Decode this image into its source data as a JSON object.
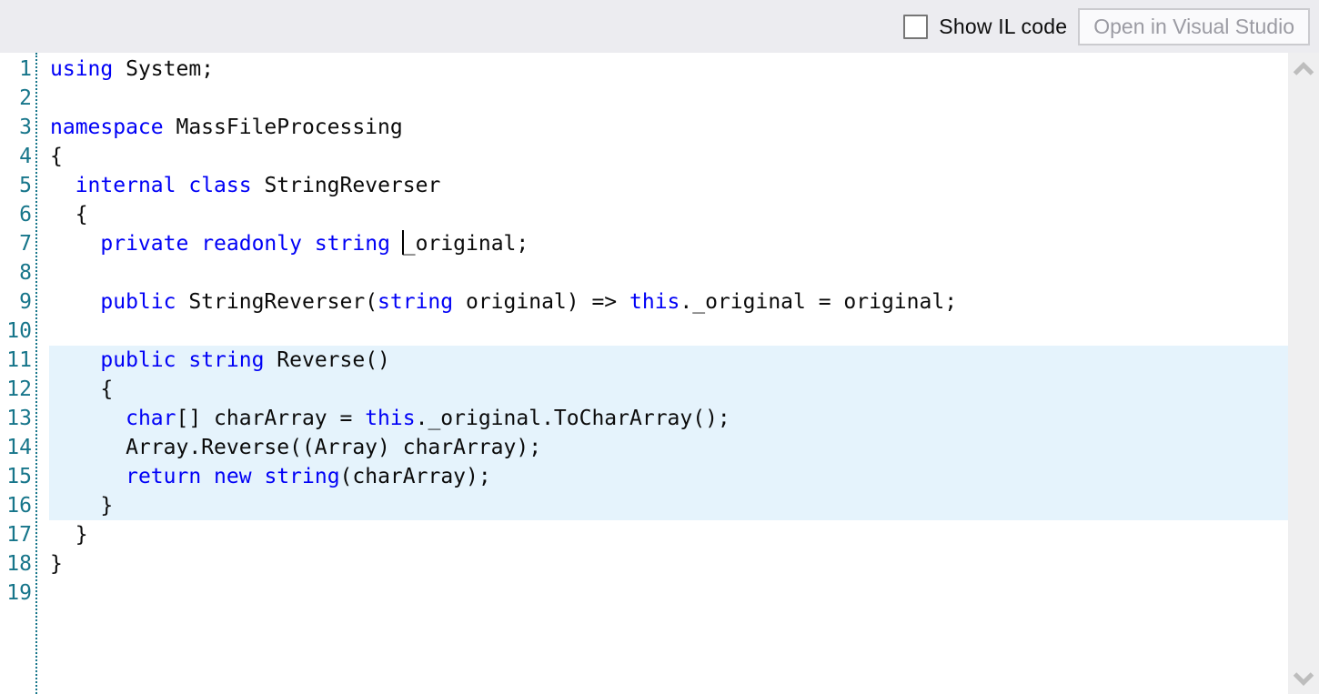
{
  "toolbar": {
    "show_il_label": "Show IL code",
    "show_il_checked": false,
    "open_vs_label": "Open in Visual Studio"
  },
  "editor": {
    "language": "csharp",
    "highlight_start_line": 11,
    "highlight_end_line": 16,
    "caret_line": 7,
    "lines": [
      {
        "n": "1",
        "tokens": [
          [
            "k",
            "using"
          ],
          [
            "p",
            " System;"
          ]
        ]
      },
      {
        "n": "2",
        "tokens": []
      },
      {
        "n": "3",
        "tokens": [
          [
            "k",
            "namespace"
          ],
          [
            "p",
            " MassFileProcessing"
          ]
        ]
      },
      {
        "n": "4",
        "tokens": [
          [
            "p",
            "{"
          ]
        ]
      },
      {
        "n": "5",
        "tokens": [
          [
            "p",
            "  "
          ],
          [
            "k",
            "internal"
          ],
          [
            "p",
            " "
          ],
          [
            "k",
            "class"
          ],
          [
            "p",
            " StringReverser"
          ]
        ]
      },
      {
        "n": "6",
        "tokens": [
          [
            "p",
            "  {"
          ]
        ]
      },
      {
        "n": "7",
        "tokens": [
          [
            "p",
            "    "
          ],
          [
            "k",
            "private"
          ],
          [
            "p",
            " "
          ],
          [
            "k",
            "readonly"
          ],
          [
            "p",
            " "
          ],
          [
            "k",
            "string"
          ],
          [
            "p",
            " "
          ],
          [
            "caret",
            ""
          ],
          [
            "p",
            "_original;"
          ]
        ]
      },
      {
        "n": "8",
        "tokens": []
      },
      {
        "n": "9",
        "tokens": [
          [
            "p",
            "    "
          ],
          [
            "k",
            "public"
          ],
          [
            "p",
            " StringReverser("
          ],
          [
            "k",
            "string"
          ],
          [
            "p",
            " original) => "
          ],
          [
            "k",
            "this"
          ],
          [
            "p",
            "._original = original;"
          ]
        ]
      },
      {
        "n": "10",
        "tokens": []
      },
      {
        "n": "11",
        "tokens": [
          [
            "p",
            "    "
          ],
          [
            "k",
            "public"
          ],
          [
            "p",
            " "
          ],
          [
            "k",
            "string"
          ],
          [
            "p",
            " Reverse()"
          ]
        ]
      },
      {
        "n": "12",
        "tokens": [
          [
            "p",
            "    {"
          ]
        ]
      },
      {
        "n": "13",
        "tokens": [
          [
            "p",
            "      "
          ],
          [
            "k",
            "char"
          ],
          [
            "p",
            "[] charArray = "
          ],
          [
            "k",
            "this"
          ],
          [
            "p",
            "._original.ToCharArray();"
          ]
        ]
      },
      {
        "n": "14",
        "tokens": [
          [
            "p",
            "      Array.Reverse((Array) charArray);"
          ]
        ]
      },
      {
        "n": "15",
        "tokens": [
          [
            "p",
            "      "
          ],
          [
            "k",
            "return"
          ],
          [
            "p",
            " "
          ],
          [
            "k",
            "new"
          ],
          [
            "p",
            " "
          ],
          [
            "k",
            "string"
          ],
          [
            "p",
            "(charArray);"
          ]
        ]
      },
      {
        "n": "16",
        "tokens": [
          [
            "p",
            "    }"
          ]
        ]
      },
      {
        "n": "17",
        "tokens": [
          [
            "p",
            "  }"
          ]
        ]
      },
      {
        "n": "18",
        "tokens": [
          [
            "p",
            "}"
          ]
        ]
      },
      {
        "n": "19",
        "tokens": []
      }
    ]
  },
  "colors": {
    "keyword": "#0000F6",
    "plain": "#0B0B0B",
    "line_number": "#16758A",
    "highlight_bg": "#E5F3FC",
    "topbar_bg": "#ECECF0",
    "scrollbar_track": "#EFEFF0",
    "scrollbar_arrow": "#BDBDBD"
  },
  "scrollbar": {
    "up_icon": "chevron-up-icon",
    "down_icon": "chevron-down-icon"
  }
}
